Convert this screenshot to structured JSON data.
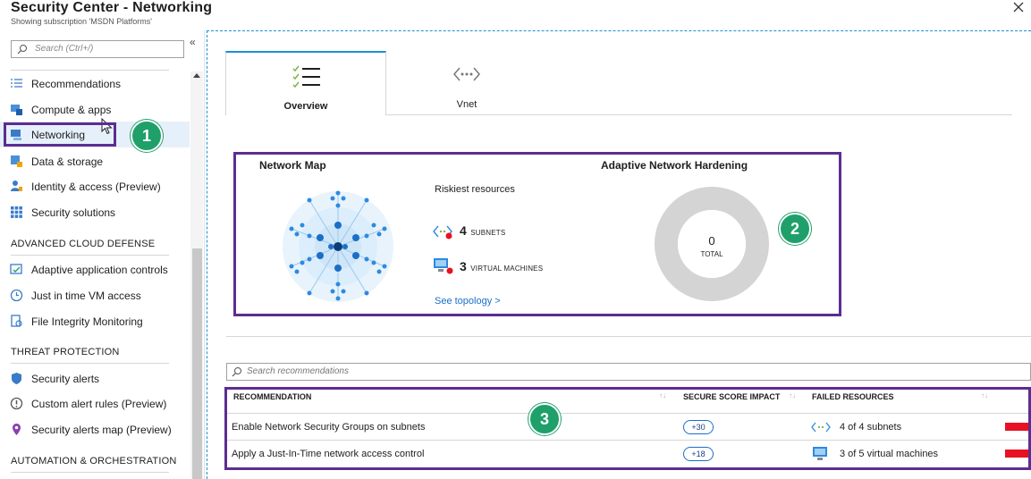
{
  "header": {
    "title": "Security Center - Networking",
    "subtitle": "Showing subscription 'MSDN Platforms'"
  },
  "sidebar": {
    "search_placeholder": "Search (Ctrl+/)",
    "items": [
      {
        "label": "Recommendations",
        "icon": "list-icon"
      },
      {
        "label": "Compute & apps",
        "icon": "compute-icon"
      },
      {
        "label": "Networking",
        "icon": "networking-icon",
        "active": true
      },
      {
        "label": "Data & storage",
        "icon": "database-icon"
      },
      {
        "label": "Identity & access (Preview)",
        "icon": "identity-icon"
      },
      {
        "label": "Security solutions",
        "icon": "grid-icon"
      }
    ],
    "sections": [
      {
        "title": "ADVANCED CLOUD DEFENSE",
        "items": [
          {
            "label": "Adaptive application controls",
            "icon": "app-control-icon"
          },
          {
            "label": "Just in time VM access",
            "icon": "clock-icon"
          },
          {
            "label": "File Integrity Monitoring",
            "icon": "file-monitor-icon"
          }
        ]
      },
      {
        "title": "THREAT PROTECTION",
        "items": [
          {
            "label": "Security alerts",
            "icon": "shield-icon"
          },
          {
            "label": "Custom alert rules (Preview)",
            "icon": "alert-icon"
          },
          {
            "label": "Security alerts map (Preview)",
            "icon": "map-pin-icon"
          }
        ]
      },
      {
        "title": "AUTOMATION & ORCHESTRATION",
        "items": []
      }
    ]
  },
  "callouts": {
    "one": "1",
    "two": "2",
    "three": "3"
  },
  "tabs": [
    {
      "label": "Overview",
      "icon": "checklist-icon",
      "active": true
    },
    {
      "label": "Vnet",
      "icon": "vnet-icon",
      "active": false
    }
  ],
  "network_map": {
    "title": "Network Map",
    "riskiest_label": "Riskiest resources",
    "subnets_count": "4",
    "subnets_label": "SUBNETS",
    "vms_count": "3",
    "vms_label": "VIRTUAL MACHINES",
    "topology_link": "See topology >"
  },
  "adaptive": {
    "title": "Adaptive Network Hardening",
    "total_value": "0",
    "total_label": "TOTAL"
  },
  "recommendations": {
    "search_placeholder": "Search recommendations",
    "columns": [
      "RECOMMENDATION",
      "SECURE SCORE IMPACT",
      "FAILED RESOURCES"
    ],
    "rows": [
      {
        "name": "Enable Network Security Groups on subnets",
        "impact": "+30",
        "failed": "4 of 4 subnets",
        "icon": "subnet-icon"
      },
      {
        "name": "Apply a Just-In-Time network access control",
        "impact": "+18",
        "failed": "3 of 5 virtual machines",
        "icon": "vm-icon"
      }
    ]
  },
  "colors": {
    "accent": "#1a90d6",
    "highlight": "#5c2d91",
    "badge": "#1fa06a",
    "danger": "#e81123"
  }
}
